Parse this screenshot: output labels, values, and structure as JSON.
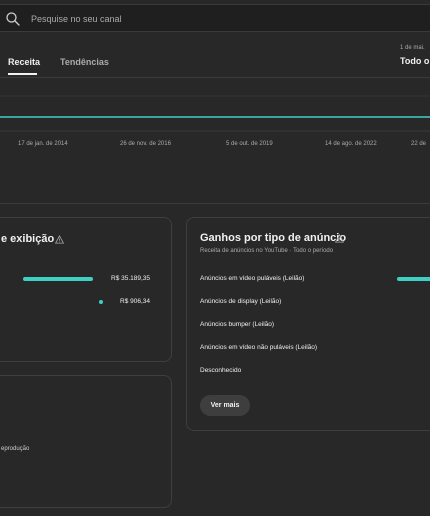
{
  "search": {
    "placeholder": "Pesquise no seu canal"
  },
  "tabs": [
    {
      "label": "Receita",
      "active": true
    },
    {
      "label": "Tendências",
      "active": false
    }
  ],
  "date_range": {
    "subtitle": "1 de mai.",
    "label": "Todo o p"
  },
  "chart": {
    "line_color": "#3ecfc5",
    "x_ticks": [
      "17 de jan. de 2014",
      "26 de nov. de 2016",
      "5 de out. de 2019",
      "14 de ago. de 2022",
      "22 de"
    ]
  },
  "left_card": {
    "title": "e exibição",
    "rows": [
      {
        "value": "R$ 35.189,35",
        "share": 1.0
      },
      {
        "value": "R$ 906,34",
        "share": 0.03
      }
    ]
  },
  "left_card_2": {
    "text": "eprodução"
  },
  "right_card": {
    "title": "Ganhos por tipo de anúncio",
    "subtitle": "Receita de anúncios no YouTube · Todo o período",
    "rows": [
      {
        "label": "Anúncios em vídeo puláveis (Leilão)"
      },
      {
        "label": "Anúncios de display (Leilão)"
      },
      {
        "label": "Anúncios bumper (Leilão)"
      },
      {
        "label": "Anúncios em vídeo não puláveis (Leilão)"
      },
      {
        "label": "Desconhecido"
      }
    ],
    "button_label": "Ver mais"
  },
  "colors": {
    "accent": "#3ecfc5",
    "background": "#282828"
  }
}
